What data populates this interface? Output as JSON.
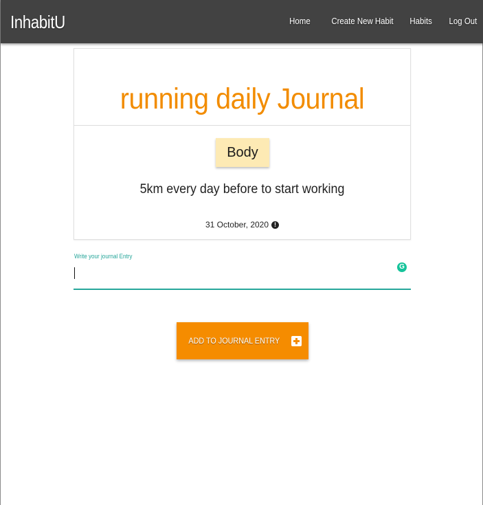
{
  "navbar": {
    "brand": "InhabitU",
    "links": [
      "Home",
      "Create New Habit",
      "Habits",
      "Log Out"
    ]
  },
  "card": {
    "title": "running daily Journal",
    "category": "Body",
    "description": "5km every day before to start working",
    "date": "31 October, 2020",
    "date_icon": "info-icon"
  },
  "entry": {
    "label": "Write your journal Entry",
    "value": "",
    "extension_icon": "grammarly-icon",
    "extension_letter": "G"
  },
  "button": {
    "label": "ADD TO JOURNAL ENTRY",
    "icon": "plus-square-icon"
  },
  "colors": {
    "navbar": "#424242",
    "title": "#f28c00",
    "chip": "#fdeab4",
    "input_accent": "#26a69a",
    "button": "#f58c00"
  }
}
